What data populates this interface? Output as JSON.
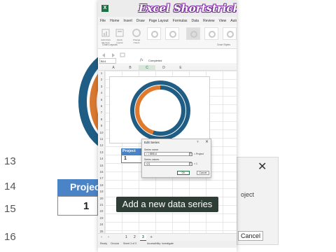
{
  "watermark": "Excel Shortstricks",
  "background": {
    "row_numbers": [
      "13",
      "14",
      "15",
      "16"
    ],
    "table_header": "Project",
    "table_value": "1",
    "dialog_text": "oject",
    "cancel_label": "Cancel"
  },
  "excel": {
    "logo": "X",
    "tabs": [
      "File",
      "Home",
      "Insert",
      "Draw",
      "Page Layout",
      "Formulas",
      "Data",
      "Review",
      "View",
      "Automate"
    ],
    "active_tab": "Insert",
    "ribbon": {
      "buttons": [
        {
          "label": "Add Chart Element",
          "icon": "add-chart-element-icon"
        },
        {
          "label": "Quick Layout",
          "icon": "quick-layout-icon"
        },
        {
          "label": "Change Colors",
          "icon": "change-colors-icon"
        }
      ],
      "groups": [
        "Chart Layouts",
        "Chart Styles"
      ]
    },
    "name_box": "B14",
    "fx": "fx",
    "formula_value": "Completed",
    "columns": [
      "A",
      "B",
      "C",
      "D",
      "E"
    ],
    "selected_column": "C",
    "rows": [
      "1",
      "2",
      "3",
      "4",
      "5",
      "6",
      "7",
      "8",
      "9",
      "10",
      "11",
      "12",
      "13",
      "14",
      "15",
      "16",
      "17",
      "18",
      "19",
      "20",
      "21",
      "22",
      "23",
      "24",
      "25"
    ],
    "table": {
      "header": "Project",
      "value": "1"
    },
    "sheet_tabs": [
      "1",
      "2",
      "3"
    ],
    "active_sheet": "3",
    "status": {
      "mode": "Ready",
      "circular": "Circular",
      "sheet": "Sheet 3 of 3",
      "accessibility": "Accessibility: Investigate"
    }
  },
  "dialog": {
    "title": "Edit Series",
    "help": "?",
    "close": "×",
    "series_name_label": "Series name:",
    "series_name_value": "= 1 $B$14",
    "series_name_result": "= Project",
    "series_values_label": "Series values:",
    "series_values_value": "={1}",
    "series_values_result": "= 1",
    "ok_label": "OK",
    "cancel_label": "Cancel"
  },
  "caption": "Add a new data series",
  "colors": {
    "outer_ring": "#1f5d84",
    "orange": "#e07a2e",
    "excel_green": "#1e7145",
    "table_blue": "#4a84c7"
  },
  "chart_data": {
    "type": "pie",
    "variant": "doughnut",
    "series": [
      {
        "values": [
          1,
          0
        ]
      },
      {
        "values": [
          0.55,
          0.45
        ]
      }
    ],
    "colors": [
      "#1f5d84",
      "#e07a2e"
    ]
  }
}
